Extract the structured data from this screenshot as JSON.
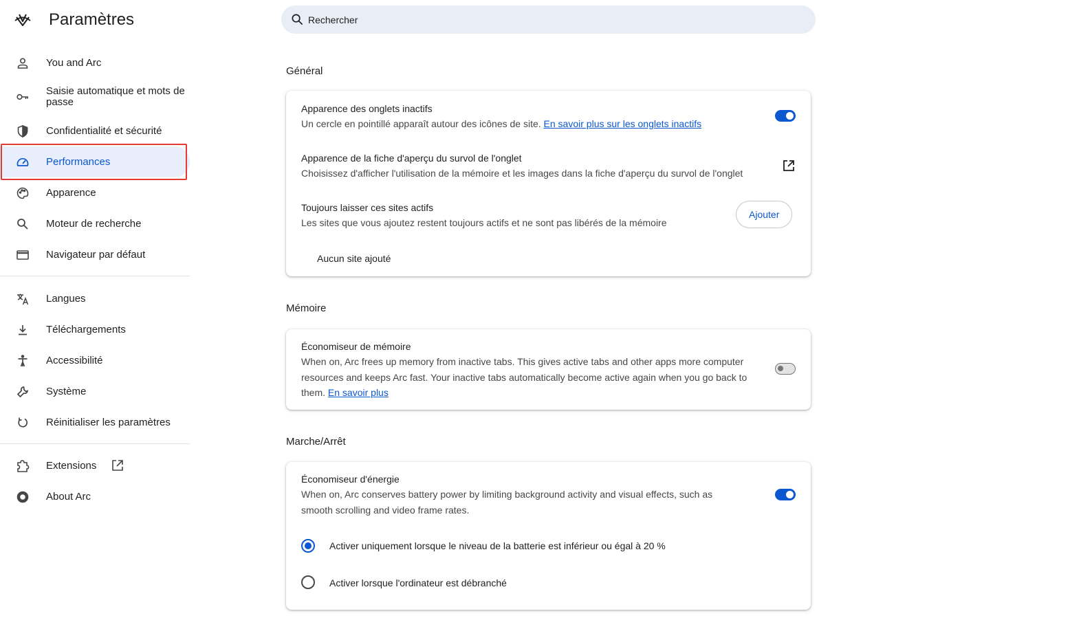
{
  "header": {
    "title": "Paramètres"
  },
  "search": {
    "placeholder": "Rechercher"
  },
  "sidebar": {
    "items": [
      {
        "label": "You and Arc",
        "icon": "person-icon"
      },
      {
        "label": "Saisie automatique et mots de passe",
        "icon": "key-icon"
      },
      {
        "label": "Confidentialité et sécurité",
        "icon": "shield-icon"
      },
      {
        "label": "Performances",
        "icon": "speedometer-icon",
        "active": true
      },
      {
        "label": "Apparence",
        "icon": "palette-icon"
      },
      {
        "label": "Moteur de recherche",
        "icon": "search-icon"
      },
      {
        "label": "Navigateur par défaut",
        "icon": "browser-window-icon"
      },
      {
        "label": "Langues",
        "icon": "translate-icon"
      },
      {
        "label": "Téléchargements",
        "icon": "download-icon"
      },
      {
        "label": "Accessibilité",
        "icon": "accessibility-icon"
      },
      {
        "label": "Système",
        "icon": "wrench-icon"
      },
      {
        "label": "Réinitialiser les paramètres",
        "icon": "reset-icon"
      },
      {
        "label": "Extensions",
        "icon": "puzzle-icon"
      },
      {
        "label": "About Arc",
        "icon": "chrome-icon"
      }
    ]
  },
  "general": {
    "title": "Général",
    "inactive_tabs": {
      "title": "Apparence des onglets inactifs",
      "desc": "Un cercle en pointillé apparaît autour des icônes de site.",
      "link": "En savoir plus sur les onglets inactifs",
      "enabled": true
    },
    "hover_card": {
      "title": "Apparence de la fiche d'aperçu du survol de l'onglet",
      "desc": "Choisissez d'afficher l'utilisation de la mémoire et les images dans la fiche d'aperçu du survol de l'onglet"
    },
    "always_active": {
      "title": "Toujours laisser ces sites actifs",
      "desc": "Les sites que vous ajoutez restent toujours actifs et ne sont pas libérés de la mémoire",
      "button": "Ajouter",
      "empty": "Aucun site ajouté"
    }
  },
  "memory": {
    "title": "Mémoire",
    "saver": {
      "title": "Économiseur de mémoire",
      "desc": "When on, Arc frees up memory from inactive tabs. This gives active tabs and other apps more computer resources and keeps Arc fast. Your inactive tabs automatically become active again when you go back to them.",
      "link": "En savoir plus",
      "enabled": false
    }
  },
  "power": {
    "title": "Marche/Arrêt",
    "saver": {
      "title": "Économiseur d'énergie",
      "desc": "When on, Arc conserves battery power by limiting background activity and visual effects, such as smooth scrolling and video frame rates.",
      "enabled": true
    },
    "options": [
      {
        "label": "Activer uniquement lorsque le niveau de la batterie est inférieur ou égal à 20 %",
        "checked": true
      },
      {
        "label": "Activer lorsque l'ordinateur est débranché",
        "checked": false
      }
    ]
  },
  "colors": {
    "accent": "#0b57d0",
    "highlight": "#e53935",
    "active_bg": "#e8eefb",
    "search_bg": "#e9eef6"
  }
}
